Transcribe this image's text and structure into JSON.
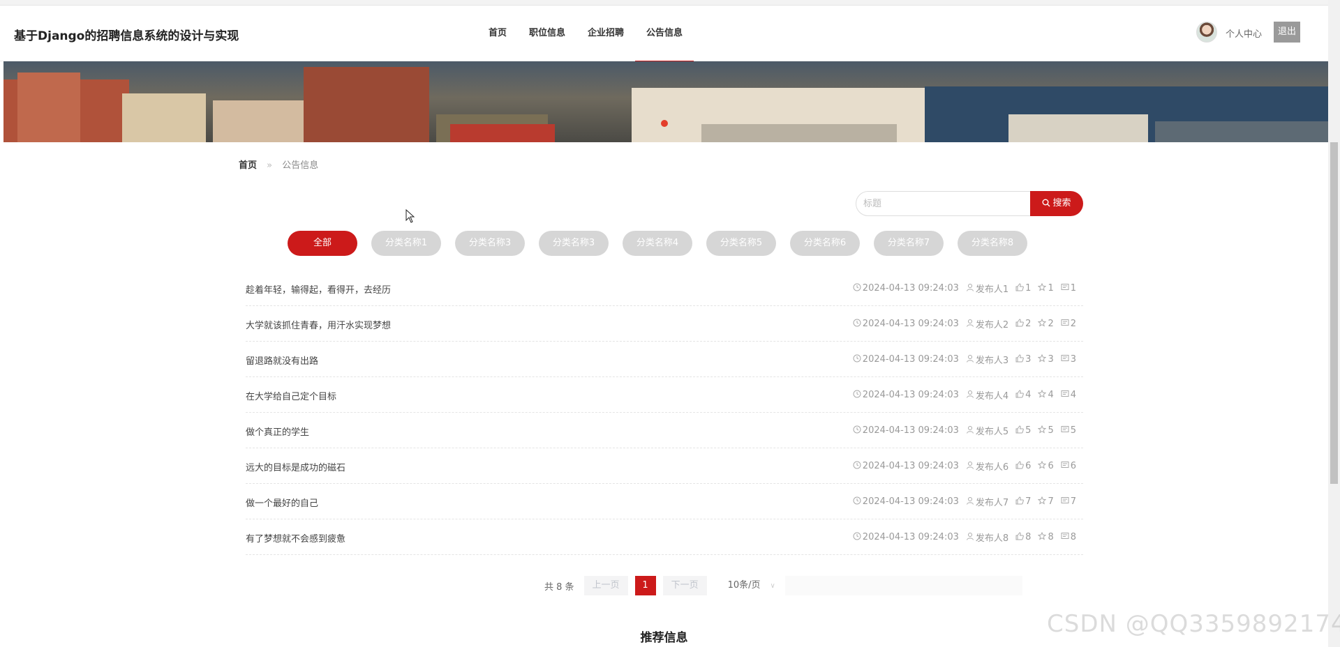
{
  "header": {
    "site_title": "基于Django的招聘信息系统的设计与实现",
    "nav": [
      {
        "label": "首页",
        "active": false
      },
      {
        "label": "职位信息",
        "active": false
      },
      {
        "label": "企业招聘",
        "active": false
      },
      {
        "label": "公告信息",
        "active": true
      }
    ],
    "user_center_label": "个人中心",
    "logout_label": "退出"
  },
  "breadcrumb": {
    "home": "首页",
    "separator": "»",
    "current": "公告信息"
  },
  "search": {
    "placeholder": "标题",
    "button_label": "搜索"
  },
  "categories": [
    {
      "label": "全部",
      "active": true
    },
    {
      "label": "分类名称1",
      "active": false
    },
    {
      "label": "分类名称3",
      "active": false
    },
    {
      "label": "分类名称3",
      "active": false
    },
    {
      "label": "分类名称4",
      "active": false
    },
    {
      "label": "分类名称5",
      "active": false
    },
    {
      "label": "分类名称6",
      "active": false
    },
    {
      "label": "分类名称7",
      "active": false
    },
    {
      "label": "分类名称8",
      "active": false
    }
  ],
  "notices": [
    {
      "title": "趁着年轻，输得起，看得开，去经历",
      "time": "2024-04-13 09:24:03",
      "publisher": "发布人1",
      "likes": "1",
      "favorites": "1",
      "comments": "1"
    },
    {
      "title": "大学就该抓住青春，用汗水实现梦想",
      "time": "2024-04-13 09:24:03",
      "publisher": "发布人2",
      "likes": "2",
      "favorites": "2",
      "comments": "2"
    },
    {
      "title": "留退路就没有出路",
      "time": "2024-04-13 09:24:03",
      "publisher": "发布人3",
      "likes": "3",
      "favorites": "3",
      "comments": "3"
    },
    {
      "title": "在大学给自己定个目标",
      "time": "2024-04-13 09:24:03",
      "publisher": "发布人4",
      "likes": "4",
      "favorites": "4",
      "comments": "4"
    },
    {
      "title": "做个真正的学生",
      "time": "2024-04-13 09:24:03",
      "publisher": "发布人5",
      "likes": "5",
      "favorites": "5",
      "comments": "5"
    },
    {
      "title": "远大的目标是成功的磁石",
      "time": "2024-04-13 09:24:03",
      "publisher": "发布人6",
      "likes": "6",
      "favorites": "6",
      "comments": "6"
    },
    {
      "title": "做一个最好的自己",
      "time": "2024-04-13 09:24:03",
      "publisher": "发布人7",
      "likes": "7",
      "favorites": "7",
      "comments": "7"
    },
    {
      "title": "有了梦想就不会感到疲惫",
      "time": "2024-04-13 09:24:03",
      "publisher": "发布人8",
      "likes": "8",
      "favorites": "8",
      "comments": "8"
    }
  ],
  "pagination": {
    "total": "共 8 条",
    "prev_label": "上一页",
    "current_page": "1",
    "next_label": "下一页",
    "page_size": "10条/页"
  },
  "section_title": "推荐信息",
  "watermark": "CSDN @QQ3359892174",
  "colors": {
    "accent": "#cc1a1a",
    "category_inactive": "#d6d6d6",
    "logout_bg": "#9a9a9a"
  }
}
